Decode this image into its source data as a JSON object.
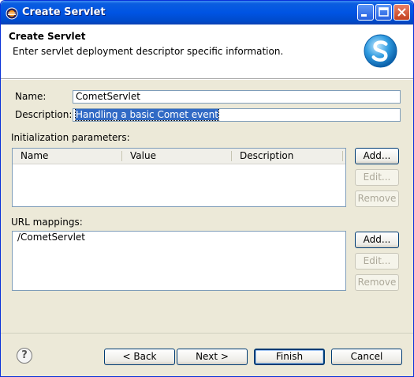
{
  "window": {
    "title": "Create Servlet"
  },
  "header": {
    "title": "Create Servlet",
    "description": "Enter servlet deployment descriptor specific information."
  },
  "fields": {
    "name_label": "Name:",
    "name_value": "CometServlet",
    "description_label": "Description:",
    "description_value": "Handling a basic Comet event"
  },
  "init_params": {
    "label": "Initialization parameters:",
    "columns": [
      "Name",
      "Value",
      "Description"
    ],
    "rows": [],
    "buttons": {
      "add": "Add...",
      "edit": "Edit...",
      "remove": "Remove"
    }
  },
  "url_mappings": {
    "label": "URL mappings:",
    "items": [
      "/CometServlet"
    ],
    "buttons": {
      "add": "Add...",
      "edit": "Edit...",
      "remove": "Remove"
    }
  },
  "footer": {
    "help_glyph": "?",
    "back": "< Back",
    "next": "Next >",
    "finish": "Finish",
    "cancel": "Cancel"
  },
  "colors": {
    "titlebar": "#0054e3",
    "selection": "#316ac5",
    "dialog_bg": "#ece9d8"
  }
}
